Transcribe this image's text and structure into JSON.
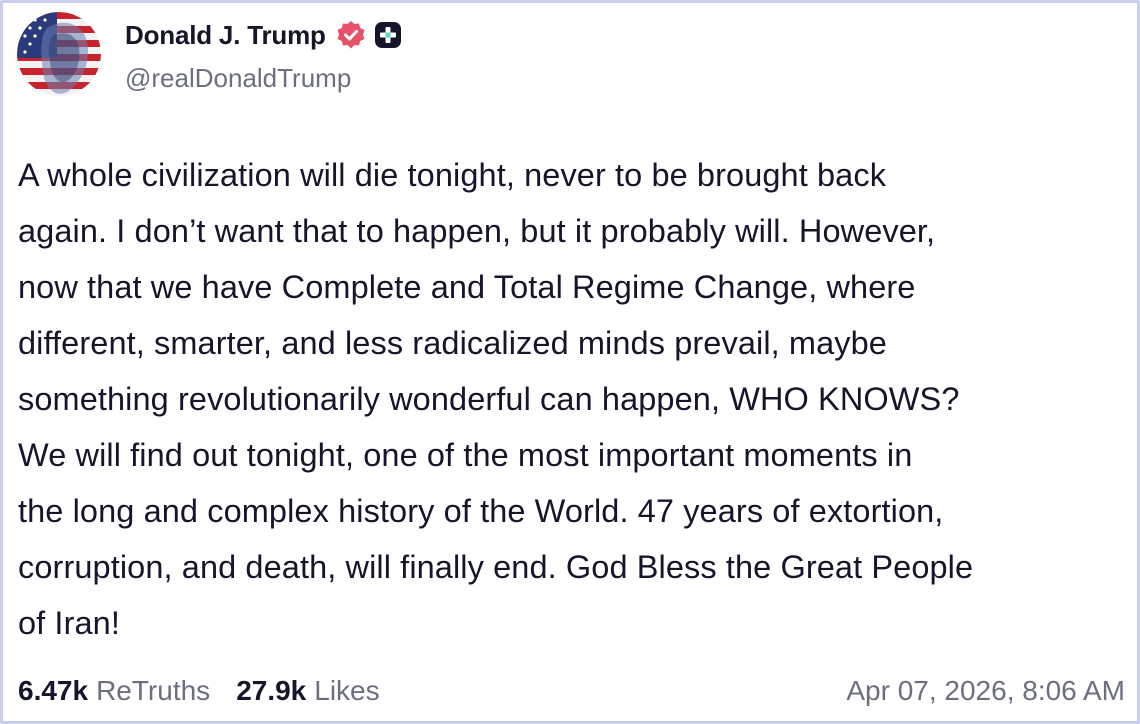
{
  "post": {
    "author": {
      "display_name": "Donald J. Trump",
      "handle": "@realDonaldTrump",
      "avatar_icon": "american-flag-portrait-avatar",
      "verified_icon": "verified-badge-icon",
      "verified_color": "#e8516a",
      "plus_icon": "plus-badge-icon"
    },
    "text": "A whole civilization will die tonight, never to be brought back\nagain. I don’t want that to happen, but it probably will. However,\nnow that we have Complete and Total Regime Change, where\ndifferent, smarter, and less radicalized minds prevail, maybe\nsomething revolutionarily wonderful can happen, WHO KNOWS?\nWe will find out tonight, one of the most important moments in\nthe long and complex history of the World. 47 years of extortion,\ncorruption, and death, will finally end. God Bless the Great People\nof Iran!",
    "stats": {
      "retruths_count": "6.47k",
      "retruths_label": "ReTruths",
      "likes_count": "27.9k",
      "likes_label": "Likes"
    },
    "timestamp": "Apr 07, 2026, 8:06 AM"
  },
  "colors": {
    "border": "#c9cdf0",
    "text": "#15152b",
    "muted": "#6c6f80"
  }
}
